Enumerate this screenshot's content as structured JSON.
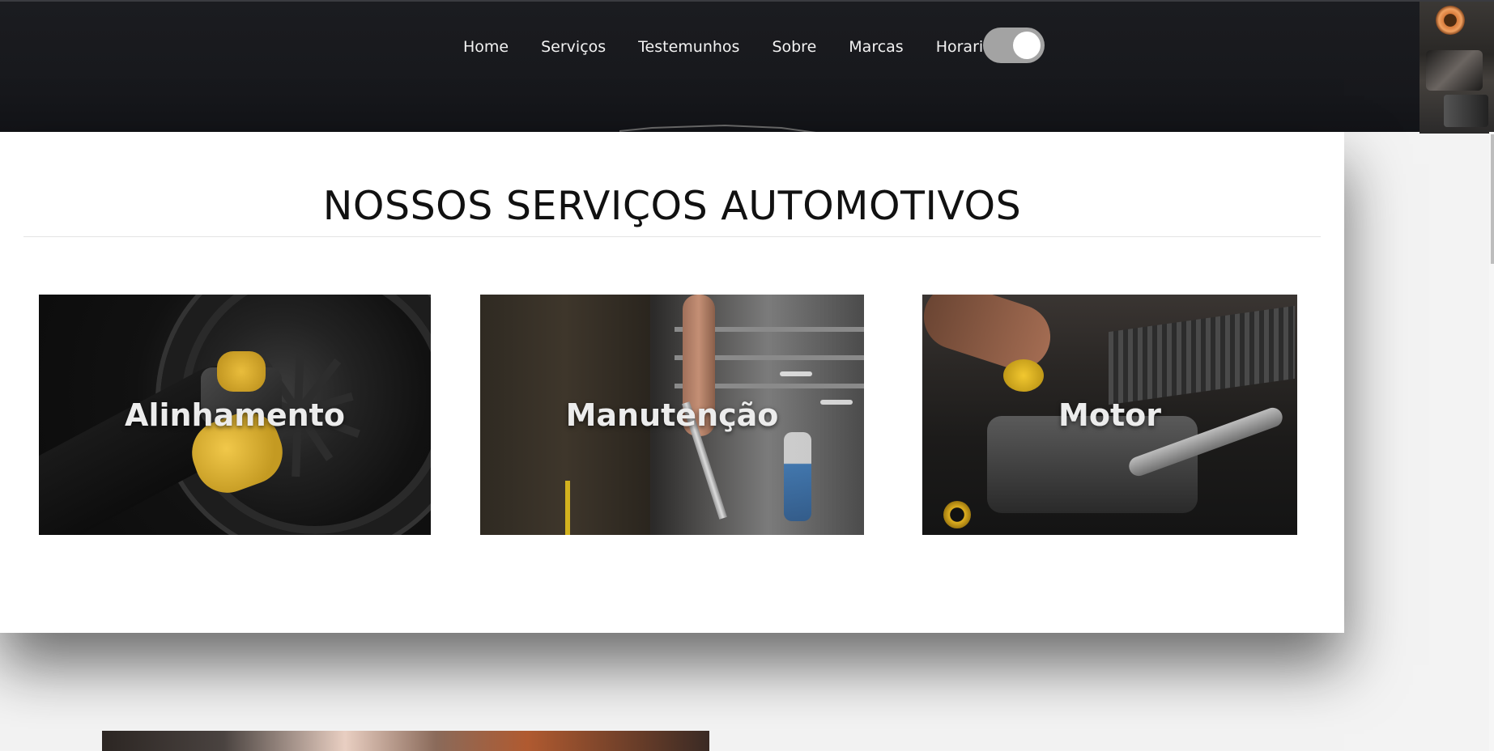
{
  "nav": {
    "items": [
      "Home",
      "Serviços",
      "Testemunhos",
      "Sobre",
      "Marcas",
      "Horario"
    ],
    "theme_toggle": {
      "state": "on"
    }
  },
  "services": {
    "title": "NOSSOS SERVIÇOS AUTOMOTIVOS",
    "cards": [
      {
        "label": "Alinhamento"
      },
      {
        "label": "Manutenção"
      },
      {
        "label": "Motor"
      }
    ]
  },
  "colors": {
    "header_bg": "#17181c",
    "nav_text": "#f2f2f2",
    "toggle_track": "#a3a3a3",
    "panel_bg": "#ffffff",
    "page_bg": "#f3f3f3"
  }
}
